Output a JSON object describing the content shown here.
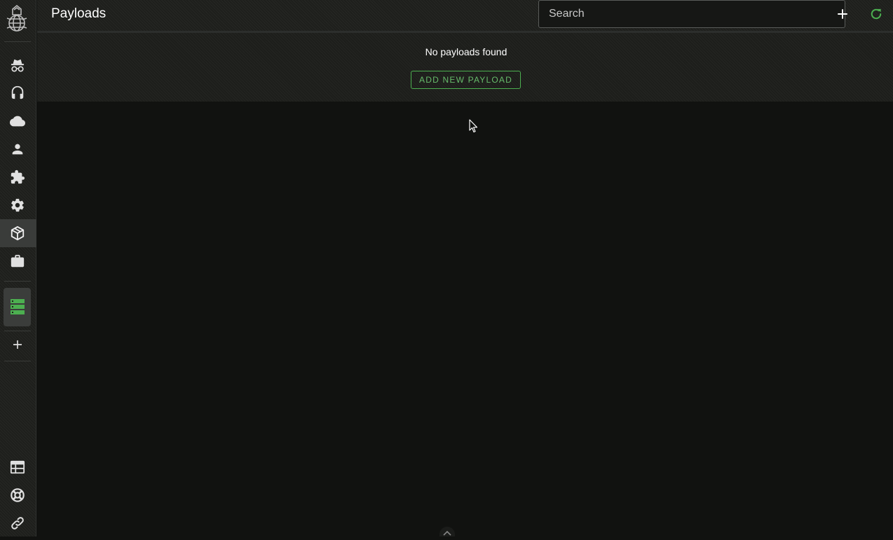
{
  "header": {
    "title": "Payloads",
    "search_placeholder": "Search"
  },
  "empty_state": {
    "message": "No payloads found",
    "add_button_label": "ADD NEW PAYLOAD"
  },
  "sidebar": {
    "items": [
      {
        "name": "operators",
        "icon": "spy-icon"
      },
      {
        "name": "c2-profiles",
        "icon": "headphones-icon"
      },
      {
        "name": "cloud",
        "icon": "cloud-icon"
      },
      {
        "name": "users",
        "icon": "person-icon"
      },
      {
        "name": "payload-types",
        "icon": "puzzle-icon"
      },
      {
        "name": "settings",
        "icon": "gear-icon"
      },
      {
        "name": "payloads",
        "icon": "cube-icon",
        "active": true
      },
      {
        "name": "operations",
        "icon": "briefcase-icon"
      },
      {
        "name": "active-callbacks",
        "icon": "server-stack-icon"
      },
      {
        "name": "add-tab",
        "icon": "plus-icon"
      },
      {
        "name": "dashboard",
        "icon": "table-icon"
      },
      {
        "name": "help",
        "icon": "life-ring-icon"
      },
      {
        "name": "links",
        "icon": "link-icon"
      }
    ]
  },
  "colors": {
    "accent_green": "#66bb6a",
    "background": "#111210",
    "sidebar_bg": "#1e1f1c"
  }
}
